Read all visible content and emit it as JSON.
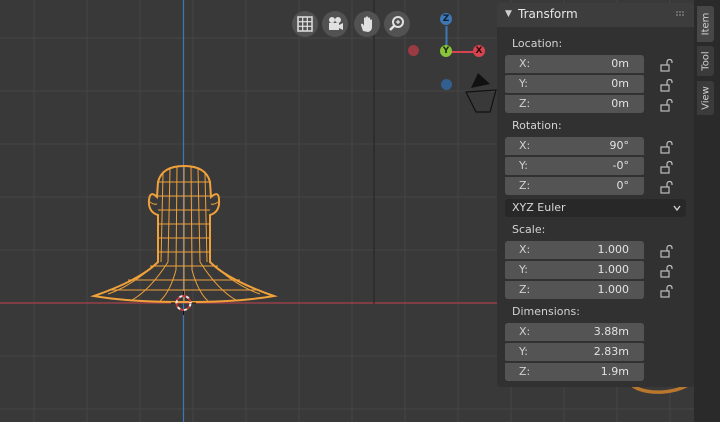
{
  "panel": {
    "title": "Transform",
    "location": {
      "label": "Location:",
      "fields": [
        {
          "axis": "X:",
          "value": "0m"
        },
        {
          "axis": "Y:",
          "value": "0m"
        },
        {
          "axis": "Z:",
          "value": "0m"
        }
      ]
    },
    "rotation": {
      "label": "Rotation:",
      "fields": [
        {
          "axis": "X:",
          "value": "90°"
        },
        {
          "axis": "Y:",
          "value": "-0°"
        },
        {
          "axis": "Z:",
          "value": "0°"
        }
      ],
      "mode": "XYZ Euler"
    },
    "scale": {
      "label": "Scale:",
      "fields": [
        {
          "axis": "X:",
          "value": "1.000"
        },
        {
          "axis": "Y:",
          "value": "1.000"
        },
        {
          "axis": "Z:",
          "value": "1.000"
        }
      ]
    },
    "dimensions": {
      "label": "Dimensions:",
      "fields": [
        {
          "axis": "X:",
          "value": "3.88m"
        },
        {
          "axis": "Y:",
          "value": "2.83m"
        },
        {
          "axis": "Z:",
          "value": "1.9m"
        }
      ]
    }
  },
  "sidebar_tabs": [
    "Item",
    "Tool",
    "View"
  ],
  "gizmo": {
    "z": "Z",
    "y": "Y",
    "x": "X"
  },
  "navigation_icons": [
    "grid-icon",
    "camera-icon",
    "hand-pan-icon",
    "zoom-icon"
  ],
  "colors": {
    "viewport_bg": "#393939",
    "grid_line": "#454545",
    "x_axis": "#a8424b",
    "z_axis": "#3e77b5",
    "wireframe": "#f0a13a",
    "annotation": "#b8772c"
  }
}
